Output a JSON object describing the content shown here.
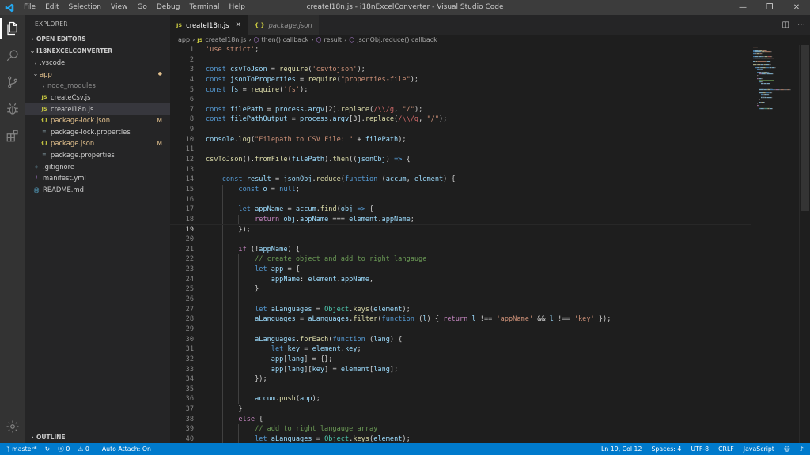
{
  "titlebar": {
    "menu": [
      "File",
      "Edit",
      "Selection",
      "View",
      "Go",
      "Debug",
      "Terminal",
      "Help"
    ],
    "title": "createI18n.js - i18nExcelConverter - Visual Studio Code"
  },
  "sidebar": {
    "title": "EXPLORER",
    "open_editors": "OPEN EDITORS",
    "project": "I18NEXCELCONVERTER",
    "outline": "OUTLINE",
    "tree": [
      {
        "label": ".vscode",
        "type": "folder",
        "depth": 0,
        "expanded": false
      },
      {
        "label": "app",
        "type": "folder",
        "depth": 0,
        "expanded": true,
        "dot": "●"
      },
      {
        "label": "node_modules",
        "type": "folder",
        "depth": 1,
        "expanded": false
      },
      {
        "label": "createCsv.js",
        "type": "js",
        "depth": 1
      },
      {
        "label": "createI18n.js",
        "type": "js",
        "depth": 1,
        "selected": true
      },
      {
        "label": "package-lock.json",
        "type": "json",
        "depth": 1,
        "badge": "M"
      },
      {
        "label": "package-lock.properties",
        "type": "props",
        "depth": 1
      },
      {
        "label": "package.json",
        "type": "json",
        "depth": 1,
        "badge": "M"
      },
      {
        "label": "package.properties",
        "type": "props",
        "depth": 1
      },
      {
        "label": ".gitignore",
        "type": "git",
        "depth": 0
      },
      {
        "label": "manifest.yml",
        "type": "yml",
        "depth": 0
      },
      {
        "label": "README.md",
        "type": "md",
        "depth": 0
      }
    ]
  },
  "tabs": [
    {
      "label": "createI18n.js",
      "icon": "JS",
      "active": true
    },
    {
      "label": "package.json",
      "icon": "{ }",
      "active": false
    }
  ],
  "breadcrumb": [
    "app",
    "createI18n.js",
    "then() callback",
    "result",
    "jsonObj.reduce() callback"
  ],
  "code": [
    {
      "n": "1",
      "s": [
        [
          "str",
          "'use strict'"
        ],
        [
          "pu",
          ";"
        ]
      ]
    },
    {
      "n": "2",
      "s": []
    },
    {
      "n": "3",
      "s": [
        [
          "kw",
          "const "
        ],
        [
          "var",
          "csvToJson"
        ],
        [
          "pu",
          " = "
        ],
        [
          "fn",
          "require"
        ],
        [
          "pu",
          "("
        ],
        [
          "str",
          "'csvtojson'"
        ],
        [
          "pu",
          ");"
        ]
      ]
    },
    {
      "n": "4",
      "s": [
        [
          "kw",
          "const "
        ],
        [
          "var",
          "jsonToProperties"
        ],
        [
          "pu",
          " = "
        ],
        [
          "fn",
          "require"
        ],
        [
          "pu",
          "("
        ],
        [
          "str",
          "\"properties-file\""
        ],
        [
          "pu",
          ");"
        ]
      ]
    },
    {
      "n": "5",
      "s": [
        [
          "kw",
          "const "
        ],
        [
          "var",
          "fs"
        ],
        [
          "pu",
          " = "
        ],
        [
          "fn",
          "require"
        ],
        [
          "pu",
          "("
        ],
        [
          "str",
          "'fs'"
        ],
        [
          "pu",
          ");"
        ]
      ]
    },
    {
      "n": "6",
      "s": []
    },
    {
      "n": "7",
      "s": [
        [
          "kw",
          "const "
        ],
        [
          "var",
          "filePath"
        ],
        [
          "pu",
          " = "
        ],
        [
          "var",
          "process"
        ],
        [
          "pu",
          "."
        ],
        [
          "var",
          "argv"
        ],
        [
          "pu",
          "[2]."
        ],
        [
          "fn",
          "replace"
        ],
        [
          "pu",
          "("
        ],
        [
          "re",
          "/\\\\/g"
        ],
        [
          "pu",
          ", "
        ],
        [
          "str",
          "\"/\""
        ],
        [
          "pu",
          ");"
        ]
      ]
    },
    {
      "n": "8",
      "s": [
        [
          "kw",
          "const "
        ],
        [
          "var",
          "filePathOutput"
        ],
        [
          "pu",
          " = "
        ],
        [
          "var",
          "process"
        ],
        [
          "pu",
          "."
        ],
        [
          "var",
          "argv"
        ],
        [
          "pu",
          "[3]."
        ],
        [
          "fn",
          "replace"
        ],
        [
          "pu",
          "("
        ],
        [
          "re",
          "/\\\\/g"
        ],
        [
          "pu",
          ", "
        ],
        [
          "str",
          "\"/\""
        ],
        [
          "pu",
          ");"
        ]
      ]
    },
    {
      "n": "9",
      "s": []
    },
    {
      "n": "10",
      "s": [
        [
          "var",
          "console"
        ],
        [
          "pu",
          "."
        ],
        [
          "fn",
          "log"
        ],
        [
          "pu",
          "("
        ],
        [
          "str",
          "\"Filepath to CSV File: \""
        ],
        [
          "pu",
          " + "
        ],
        [
          "var",
          "filePath"
        ],
        [
          "pu",
          ");"
        ]
      ]
    },
    {
      "n": "11",
      "s": []
    },
    {
      "n": "12",
      "s": [
        [
          "fn",
          "csvToJson"
        ],
        [
          "pu",
          "()."
        ],
        [
          "fn",
          "fromFile"
        ],
        [
          "pu",
          "("
        ],
        [
          "var",
          "filePath"
        ],
        [
          "pu",
          ")."
        ],
        [
          "fn",
          "then"
        ],
        [
          "pu",
          "(("
        ],
        [
          "var",
          "jsonObj"
        ],
        [
          "pu",
          ") "
        ],
        [
          "kw",
          "=>"
        ],
        [
          "pu",
          " {"
        ]
      ]
    },
    {
      "n": "13",
      "s": []
    },
    {
      "n": "14",
      "i": 1,
      "s": [
        [
          "kw",
          "const "
        ],
        [
          "var",
          "result"
        ],
        [
          "pu",
          " = "
        ],
        [
          "var",
          "jsonObj"
        ],
        [
          "pu",
          "."
        ],
        [
          "fn",
          "reduce"
        ],
        [
          "pu",
          "("
        ],
        [
          "kw",
          "function "
        ],
        [
          "pu",
          "("
        ],
        [
          "var",
          "accum"
        ],
        [
          "pu",
          ", "
        ],
        [
          "var",
          "element"
        ],
        [
          "pu",
          ") {"
        ]
      ]
    },
    {
      "n": "15",
      "i": 2,
      "s": [
        [
          "kw",
          "const "
        ],
        [
          "var",
          "o"
        ],
        [
          "pu",
          " = "
        ],
        [
          "kw",
          "null"
        ],
        [
          "pu",
          ";"
        ]
      ]
    },
    {
      "n": "16",
      "i": 2,
      "s": []
    },
    {
      "n": "17",
      "i": 2,
      "s": [
        [
          "kw",
          "let "
        ],
        [
          "var",
          "appName"
        ],
        [
          "pu",
          " = "
        ],
        [
          "var",
          "accum"
        ],
        [
          "pu",
          "."
        ],
        [
          "fn",
          "find"
        ],
        [
          "pu",
          "("
        ],
        [
          "var",
          "obj"
        ],
        [
          "pu",
          " "
        ],
        [
          "kw",
          "=>"
        ],
        [
          "pu",
          " {"
        ]
      ]
    },
    {
      "n": "18",
      "i": 3,
      "s": [
        [
          "ctl",
          "return "
        ],
        [
          "var",
          "obj"
        ],
        [
          "pu",
          "."
        ],
        [
          "var",
          "appName"
        ],
        [
          "pu",
          " === "
        ],
        [
          "var",
          "element"
        ],
        [
          "pu",
          "."
        ],
        [
          "var",
          "appName"
        ],
        [
          "pu",
          ";"
        ]
      ]
    },
    {
      "n": "19",
      "i": 2,
      "cur": true,
      "s": [
        [
          "pu",
          "});"
        ]
      ]
    },
    {
      "n": "20",
      "i": 2,
      "s": []
    },
    {
      "n": "21",
      "i": 2,
      "s": [
        [
          "ctl",
          "if "
        ],
        [
          "pu",
          "(!"
        ],
        [
          "var",
          "appName"
        ],
        [
          "pu",
          ") {"
        ]
      ]
    },
    {
      "n": "22",
      "i": 3,
      "s": [
        [
          "cmt",
          "// create object and add to right langauge"
        ]
      ]
    },
    {
      "n": "23",
      "i": 3,
      "s": [
        [
          "kw",
          "let "
        ],
        [
          "var",
          "app"
        ],
        [
          "pu",
          " = {"
        ]
      ]
    },
    {
      "n": "24",
      "i": 4,
      "s": [
        [
          "var",
          "appName"
        ],
        [
          "pu",
          ": "
        ],
        [
          "var",
          "element"
        ],
        [
          "pu",
          "."
        ],
        [
          "var",
          "appName"
        ],
        [
          "pu",
          ","
        ]
      ]
    },
    {
      "n": "25",
      "i": 3,
      "s": [
        [
          "pu",
          "}"
        ]
      ]
    },
    {
      "n": "26",
      "i": 3,
      "s": []
    },
    {
      "n": "27",
      "i": 3,
      "s": [
        [
          "kw",
          "let "
        ],
        [
          "var",
          "aLanguages"
        ],
        [
          "pu",
          " = "
        ],
        [
          "cls",
          "Object"
        ],
        [
          "pu",
          "."
        ],
        [
          "fn",
          "keys"
        ],
        [
          "pu",
          "("
        ],
        [
          "var",
          "element"
        ],
        [
          "pu",
          ");"
        ]
      ]
    },
    {
      "n": "28",
      "i": 3,
      "s": [
        [
          "var",
          "aLanguages"
        ],
        [
          "pu",
          " = "
        ],
        [
          "var",
          "aLanguages"
        ],
        [
          "pu",
          "."
        ],
        [
          "fn",
          "filter"
        ],
        [
          "pu",
          "("
        ],
        [
          "kw",
          "function "
        ],
        [
          "pu",
          "("
        ],
        [
          "var",
          "l"
        ],
        [
          "pu",
          ") { "
        ],
        [
          "ctl",
          "return "
        ],
        [
          "var",
          "l"
        ],
        [
          "pu",
          " !== "
        ],
        [
          "str",
          "'appName'"
        ],
        [
          "pu",
          " && "
        ],
        [
          "var",
          "l"
        ],
        [
          "pu",
          " !== "
        ],
        [
          "str",
          "'key'"
        ],
        [
          "pu",
          " });"
        ]
      ]
    },
    {
      "n": "29",
      "i": 3,
      "s": []
    },
    {
      "n": "30",
      "i": 3,
      "s": [
        [
          "var",
          "aLanguages"
        ],
        [
          "pu",
          "."
        ],
        [
          "fn",
          "forEach"
        ],
        [
          "pu",
          "("
        ],
        [
          "kw",
          "function "
        ],
        [
          "pu",
          "("
        ],
        [
          "var",
          "lang"
        ],
        [
          "pu",
          ") {"
        ]
      ]
    },
    {
      "n": "31",
      "i": 4,
      "s": [
        [
          "kw",
          "let "
        ],
        [
          "var",
          "key"
        ],
        [
          "pu",
          " = "
        ],
        [
          "var",
          "element"
        ],
        [
          "pu",
          "."
        ],
        [
          "var",
          "key"
        ],
        [
          "pu",
          ";"
        ]
      ]
    },
    {
      "n": "32",
      "i": 4,
      "s": [
        [
          "var",
          "app"
        ],
        [
          "pu",
          "["
        ],
        [
          "var",
          "lang"
        ],
        [
          "pu",
          "] = {};"
        ]
      ]
    },
    {
      "n": "33",
      "i": 4,
      "s": [
        [
          "var",
          "app"
        ],
        [
          "pu",
          "["
        ],
        [
          "var",
          "lang"
        ],
        [
          "pu",
          "]["
        ],
        [
          "var",
          "key"
        ],
        [
          "pu",
          "] = "
        ],
        [
          "var",
          "element"
        ],
        [
          "pu",
          "["
        ],
        [
          "var",
          "lang"
        ],
        [
          "pu",
          "];"
        ]
      ]
    },
    {
      "n": "34",
      "i": 3,
      "s": [
        [
          "pu",
          "});"
        ]
      ]
    },
    {
      "n": "35",
      "i": 3,
      "s": []
    },
    {
      "n": "36",
      "i": 3,
      "s": [
        [
          "var",
          "accum"
        ],
        [
          "pu",
          "."
        ],
        [
          "fn",
          "push"
        ],
        [
          "pu",
          "("
        ],
        [
          "var",
          "app"
        ],
        [
          "pu",
          ");"
        ]
      ]
    },
    {
      "n": "37",
      "i": 2,
      "s": [
        [
          "pu",
          "}"
        ]
      ]
    },
    {
      "n": "38",
      "i": 2,
      "s": [
        [
          "ctl",
          "else"
        ],
        [
          "pu",
          " {"
        ]
      ]
    },
    {
      "n": "39",
      "i": 3,
      "s": [
        [
          "cmt",
          "// add to right langauge array"
        ]
      ]
    },
    {
      "n": "40",
      "i": 3,
      "s": [
        [
          "kw",
          "let "
        ],
        [
          "var",
          "aLanguages"
        ],
        [
          "pu",
          " = "
        ],
        [
          "cls",
          "Object"
        ],
        [
          "pu",
          "."
        ],
        [
          "fn",
          "keys"
        ],
        [
          "pu",
          "("
        ],
        [
          "var",
          "element"
        ],
        [
          "pu",
          ");"
        ]
      ]
    }
  ],
  "statusbar": {
    "branch": "master*",
    "sync": "↻",
    "errors": "ⓧ 0",
    "warnings": "⚠ 0",
    "auto_attach": "Auto Attach: On",
    "position": "Ln 19, Col 12",
    "spaces": "Spaces: 4",
    "encoding": "UTF-8",
    "eol": "CRLF",
    "language": "JavaScript",
    "feedback": "☺",
    "bell": "♪"
  },
  "colors": {
    "statusbar": "#007acc",
    "activity_bar": "#333333",
    "sidebar": "#252526",
    "editor": "#1e1e1e",
    "modified": "#e2c08d"
  }
}
